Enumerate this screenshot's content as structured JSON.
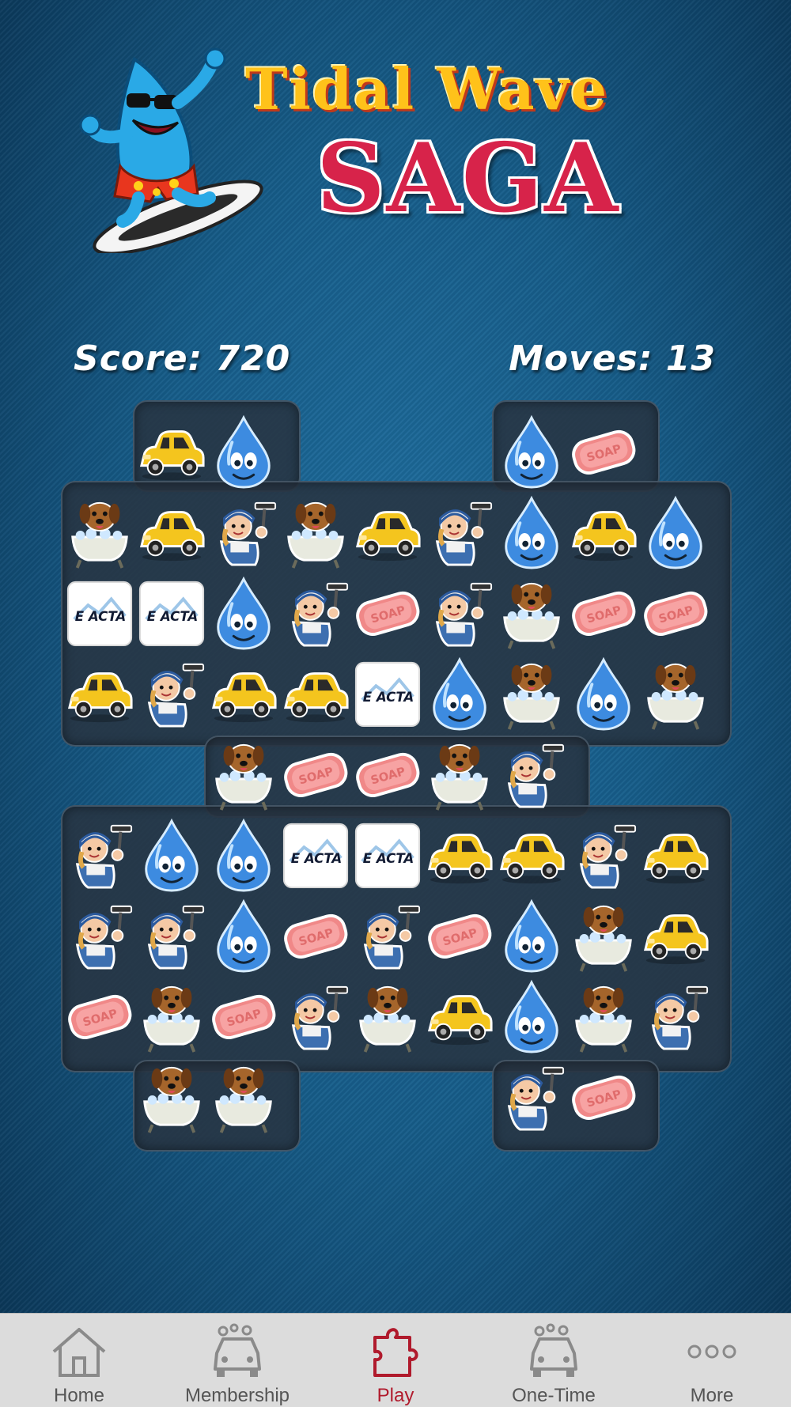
{
  "game": {
    "title_line1": "Tidal Wave",
    "title_line2": "SAGA",
    "score_label": "Score: 720",
    "moves_label": "Moves: 13",
    "score": 720,
    "moves": 13
  },
  "board": {
    "rows": [
      [
        "",
        "",
        "car",
        "drop",
        "",
        "",
        "",
        "drop",
        "soap",
        ""
      ],
      [
        "",
        "dog",
        "car",
        "washer",
        "dog",
        "car",
        "washer",
        "drop",
        "car",
        "drop"
      ],
      [
        "",
        "exacta",
        "exacta",
        "drop",
        "washer",
        "soap",
        "washer",
        "dog",
        "soap",
        "soap"
      ],
      [
        "",
        "car",
        "washer",
        "car",
        "car",
        "exacta",
        "drop",
        "dog",
        "drop",
        "dog"
      ],
      [
        "",
        "",
        "",
        "dog",
        "soap",
        "soap",
        "dog",
        "washer",
        "",
        ""
      ],
      [
        "",
        "washer",
        "drop",
        "drop",
        "exacta",
        "exacta",
        "car",
        "car",
        "washer",
        "car"
      ],
      [
        "",
        "washer",
        "washer",
        "drop",
        "soap",
        "washer",
        "soap",
        "drop",
        "dog",
        "car"
      ],
      [
        "",
        "soap",
        "dog",
        "soap",
        "washer",
        "dog",
        "car",
        "drop",
        "dog",
        "washer"
      ],
      [
        "",
        "",
        "dog",
        "dog",
        "",
        "",
        "",
        "washer",
        "soap",
        ""
      ]
    ],
    "tile_texts": {
      "soap": "SOAP",
      "exacta": "E ACTA"
    }
  },
  "tabbar": {
    "items": [
      {
        "label": "Home",
        "icon": "home-icon",
        "active": false
      },
      {
        "label": "Membership",
        "icon": "car-wash-icon",
        "active": false
      },
      {
        "label": "Play",
        "icon": "puzzle-icon",
        "active": true
      },
      {
        "label": "One-Time",
        "icon": "car-wash-icon",
        "active": false
      },
      {
        "label": "More",
        "icon": "more-dots-icon",
        "active": false
      }
    ]
  },
  "colors": {
    "active_tab": "#b01a2c",
    "inactive_tab": "#8a8a8a",
    "title_yellow": "#ffc21a",
    "title_red": "#d7234a"
  }
}
